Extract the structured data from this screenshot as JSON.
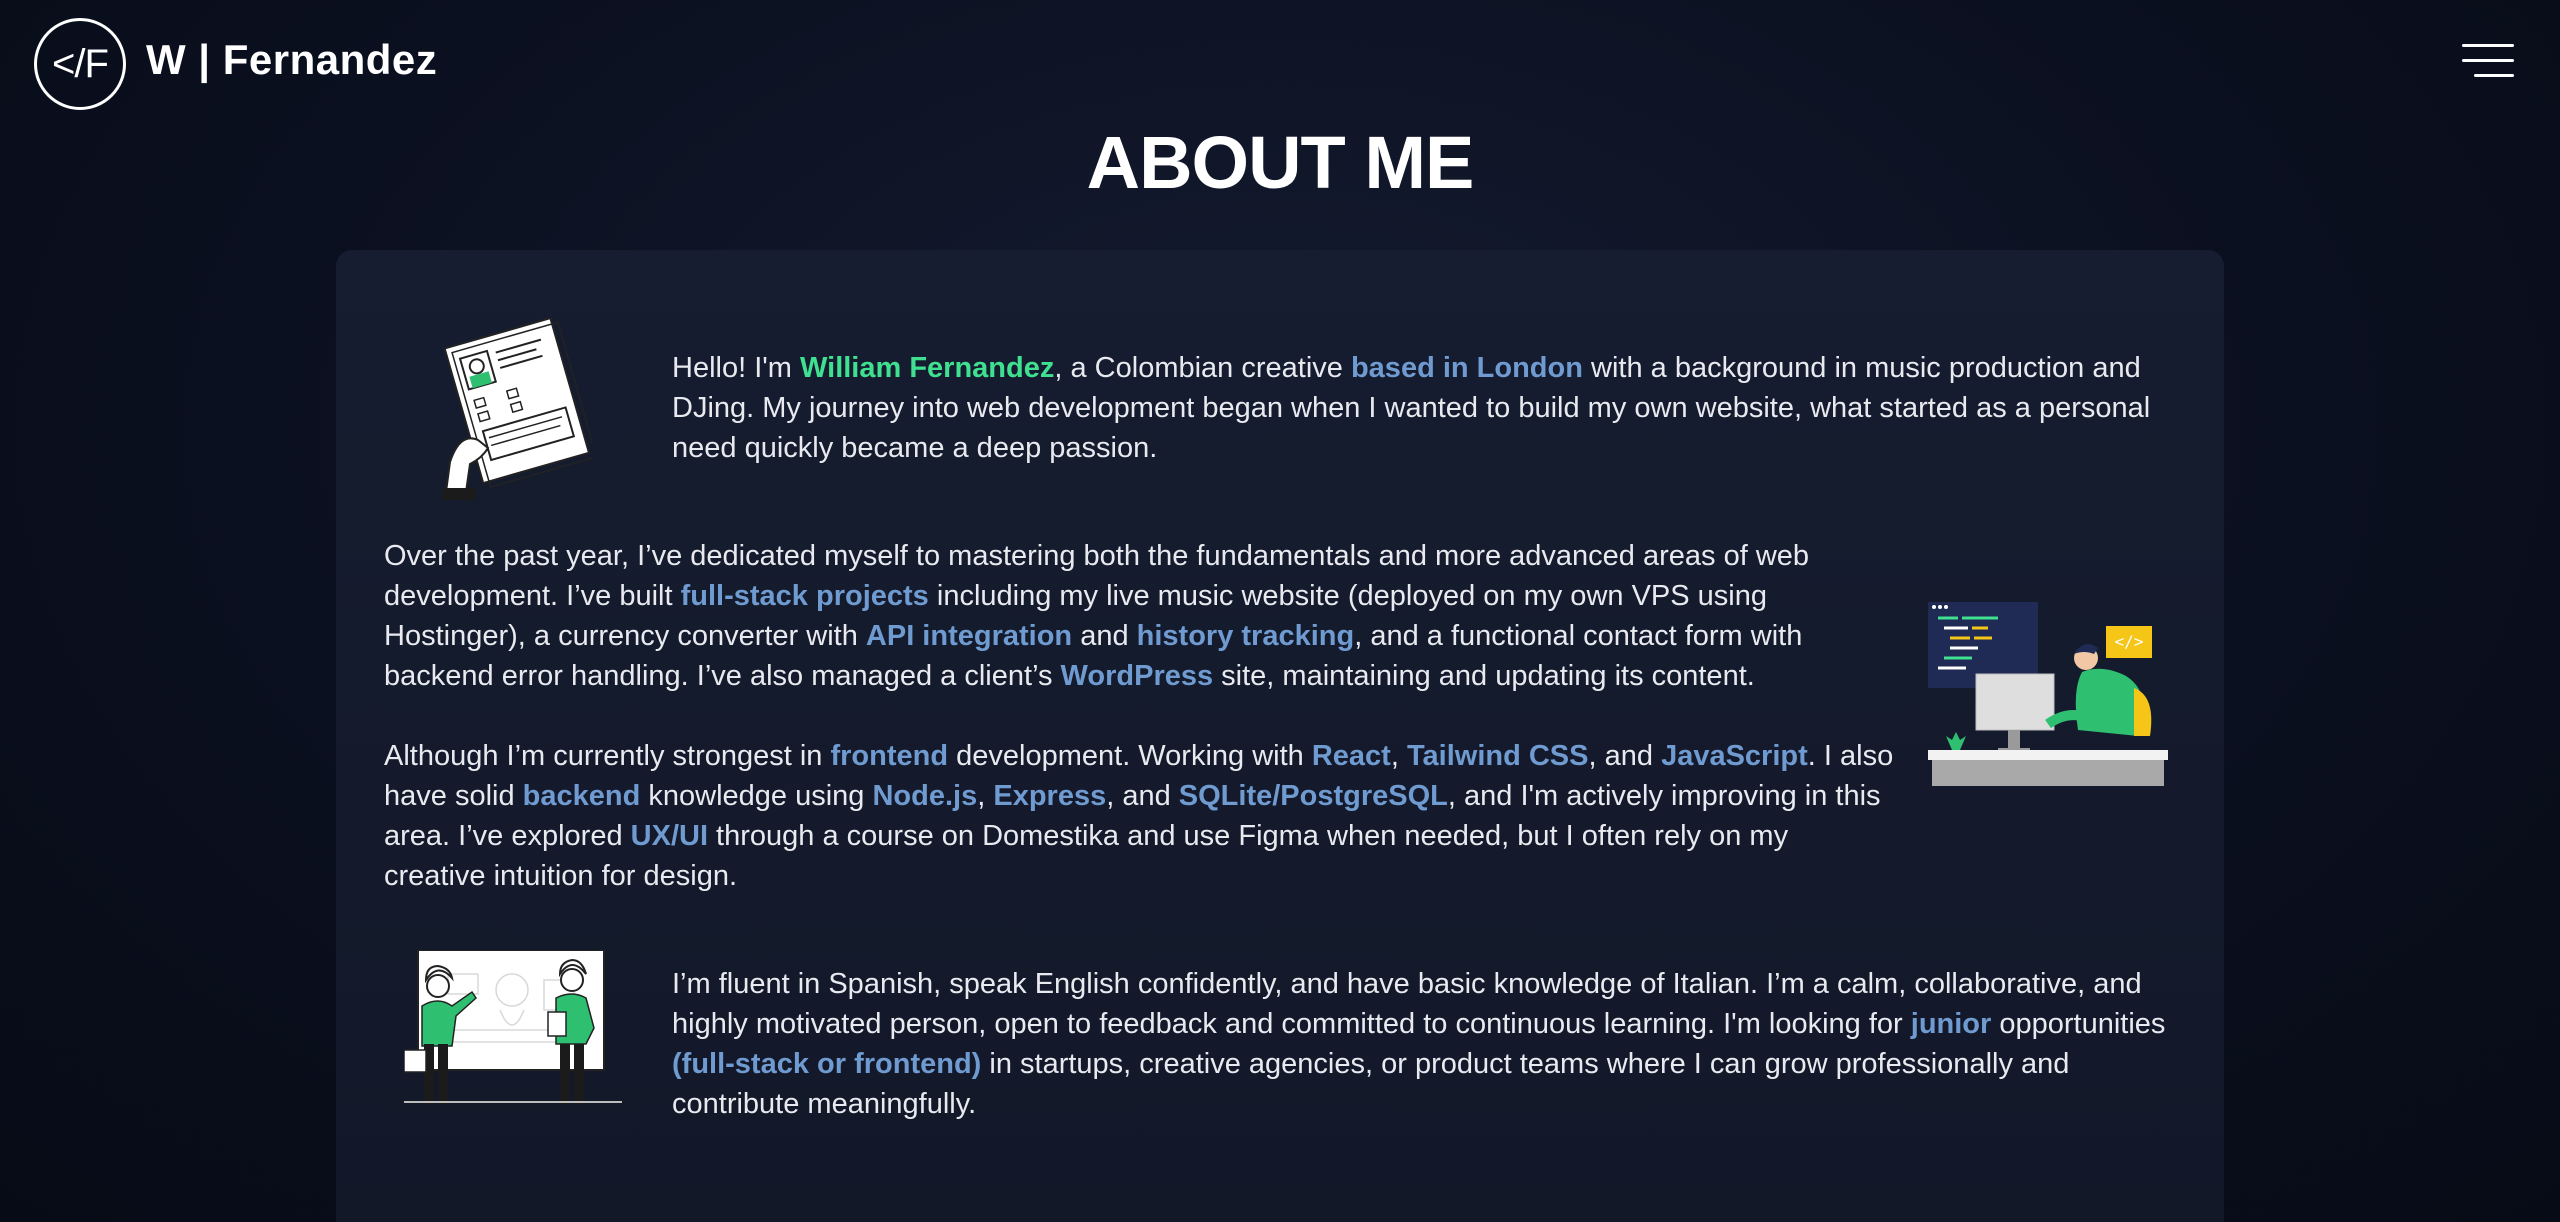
{
  "header": {
    "logo_text": "</F",
    "brand": "W | Fernandez",
    "menu_icon": "hamburger-menu-icon"
  },
  "page": {
    "title": "ABOUT ME"
  },
  "colors": {
    "accent_blue": "#6f9bd1",
    "accent_green": "#3fe08f",
    "background": "#0b1020",
    "card": "#151c2e"
  },
  "about": {
    "p1": {
      "t1": "Hello! I'm ",
      "name": "William Fernandez",
      "t2": ", a Colombian creative ",
      "location": "based in London",
      "t3": " with a background in music production and DJing. My journey into web development began when I wanted to build my own website, what started as a personal need quickly became a deep passion."
    },
    "p2": {
      "t1": "Over the past year, I’ve dedicated myself to mastering both the fundamentals and more advanced areas of web development. I’ve built ",
      "h1": "full-stack projects",
      "t2": " including my live music website (deployed on my own VPS using Hostinger), a currency converter with ",
      "h2": "API integration",
      "t3": " and ",
      "h3": "history tracking",
      "t4": ", and a functional contact form with backend error handling. I’ve also managed a client’s ",
      "h4": "WordPress",
      "t5": " site, maintaining and updating its content."
    },
    "p3": {
      "t1": "Although I’m currently strongest in ",
      "h1": "frontend",
      "t2": " development. Working with ",
      "h2": "React",
      "t3": ", ",
      "h3": "Tailwind CSS",
      "t4": ", and ",
      "h4": "JavaScript",
      "t5": ". I also have solid ",
      "h5": "backend",
      "t6": " knowledge using ",
      "h6": "Node.js",
      "t7": ", ",
      "h7": "Express",
      "t8": ", and ",
      "h8": "SQLite/PostgreSQL",
      "t9": ", and I'm actively improving in this area. I’ve explored ",
      "h9": "UX/UI",
      "t10": " through a course on Domestika and use Figma when needed, but I often rely on my creative intuition for design."
    },
    "p4": {
      "t1": "I’m fluent in Spanish, speak English confidently, and have basic knowledge of Italian. I’m a calm, collaborative, and highly motivated person, open to feedback and committed to continuous learning. I'm looking for ",
      "h1": "junior",
      "t2": " opportunities ",
      "h2": "(full-stack or frontend)",
      "t3": " in startups, creative agencies, or product teams where I can grow professionally and contribute meaningfully."
    }
  },
  "illustrations": {
    "one": "resume-document-illustration",
    "two": "developer-at-desk-illustration",
    "three": "presentation-whiteboard-illustration",
    "code_badge": "</>"
  }
}
